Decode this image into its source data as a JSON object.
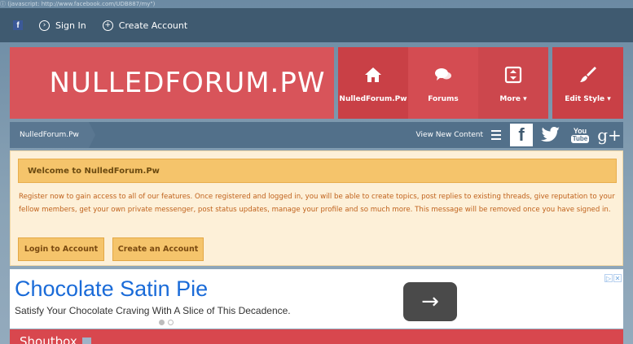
{
  "url_hint": "ⓘ (javascript: http://www.facebook.com/UDB887/my\")",
  "topbar": {
    "facebook_icon": "f",
    "sign_in": "Sign In",
    "create_account": "Create Account"
  },
  "header": {
    "logo_text": "NULLEDFORUM.PW",
    "nav": [
      {
        "label": "NulledForum.Pw",
        "icon": "home-icon"
      },
      {
        "label": "Forums",
        "icon": "chat-icon"
      },
      {
        "label": "More ▾",
        "icon": "more-icon"
      },
      {
        "label": "Edit Style ▾",
        "icon": "brush-icon"
      }
    ]
  },
  "breadcrumb": {
    "home": "NulledForum.Pw",
    "view_new_content": "View New Content",
    "social": {
      "facebook": "f",
      "twitter": "🐦",
      "youtube_top": "You",
      "youtube_bottom": "Tube",
      "gplus": "g+"
    }
  },
  "welcome": {
    "title": "Welcome to NulledForum.Pw",
    "text": "Register now to gain access to all of our features. Once registered and logged in, you will be able to create topics, post replies to existing threads, give reputation to your fellow members, get your own private messenger, post status updates, manage your profile and so much more. This message will be removed once you have signed in.",
    "login_button": "Login to Account",
    "create_button": "Create an Account"
  },
  "ad": {
    "title": "Chocolate Satin Pie",
    "subtitle": "Satisfy Your Chocolate Craving With A Slice of This Decadence.",
    "arrow": "→",
    "choices": "▷",
    "close": "✕"
  },
  "shoutbox": {
    "title": "Shoutbox"
  },
  "colors": {
    "header_red": "#d8545a",
    "top_bar": "#3f5a70",
    "breadcrumb_bar": "#52708a",
    "welcome_bg": "#fdf0d8",
    "welcome_title_bg": "#f5c46b",
    "ad_link_blue": "#1a6bd8"
  }
}
